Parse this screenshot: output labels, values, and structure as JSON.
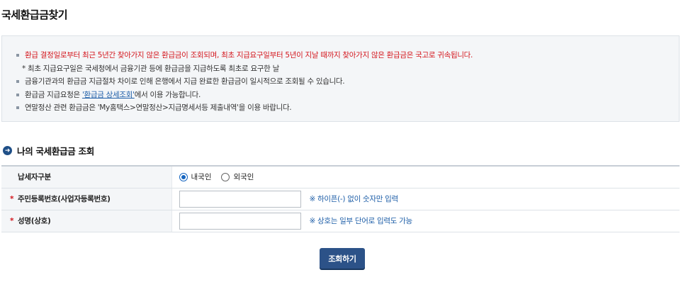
{
  "page": {
    "title": "국세환급금찾기"
  },
  "notice": {
    "line1": "환급 결정일로부터 최근 5년간 찾아가지 않은 환급금이 조회되며, 최초 지급요구일부터 5년이 지날 때까지 찾아가지 않은 환급금은 국고로 귀속됩니다.",
    "line1_sub": "* 최초 지급요구일은 국세청에서 금융기관 등에 환급금을 지급하도록 최초로 요구한 날",
    "line2": "금융기관과의 환급금 지급절차 차이로 인해 은행에서 지급 완료한 환급금이 일시적으로 조회될 수 있습니다.",
    "line3_prefix": "환급금 지급요청은 ",
    "line3_link": "'환급금 상세조회'",
    "line3_suffix": "에서 이용 가능합니다.",
    "line4": "연말정산 관련 환급금은 'My홈택스>연말정산>지급명세서등 제출내역'을 이용 바랍니다."
  },
  "section": {
    "title": "나의 국세환급금 조회"
  },
  "form": {
    "taxpayer_type": {
      "label": "납세자구분",
      "options": [
        "내국인",
        "외국인"
      ],
      "selected": "내국인"
    },
    "reg_number": {
      "label": "주민등록번호(사업자등록번호)",
      "required_mark": "*",
      "value": "",
      "hint": "※ 하이픈(-) 없이 숫자만 입력"
    },
    "name": {
      "label": "성명(상호)",
      "required_mark": "*",
      "value": "",
      "hint": "※ 상호는 일부 단어로 입력도 가능"
    }
  },
  "actions": {
    "search_label": "조회하기"
  },
  "colors": {
    "accent": "#2c5288",
    "warning": "#d4161d",
    "link": "#1f5fa8"
  }
}
